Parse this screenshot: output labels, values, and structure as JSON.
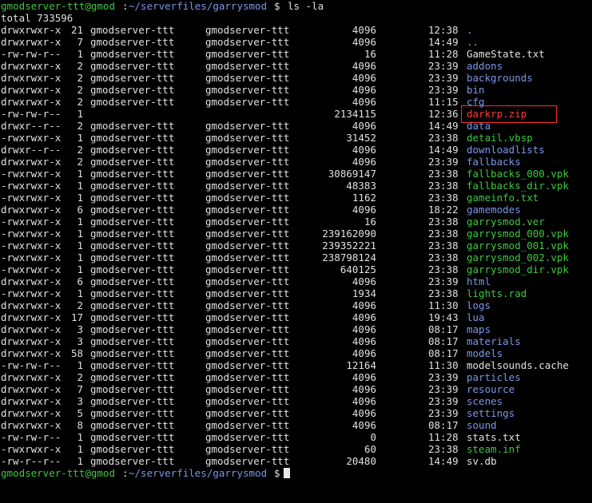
{
  "prompt": {
    "user_host": "gmodserver-ttt@gmod",
    "path": "~/serverfiles/garrysmod",
    "symbol": "$",
    "command": "ls -la"
  },
  "total_line": "total 733596",
  "colors": {
    "background": "#000000",
    "prompt_user": "#3cc83c",
    "directory": "#7a96e8",
    "executable": "#3cc83c",
    "highlight_border": "#ff2a2a"
  },
  "rows": [
    {
      "perm": "drwxrwxr-x",
      "links": "21",
      "owner": "gmodserver-ttt",
      "group": "gmodserver-ttt",
      "size": "4096",
      "time": "12:38",
      "name": ".",
      "type": "dir"
    },
    {
      "perm": "drwxrwxr-x",
      "links": "7",
      "owner": "gmodserver-ttt",
      "group": "gmodserver-ttt",
      "size": "4096",
      "time": "14:49",
      "name": "..",
      "type": "dir"
    },
    {
      "perm": "-rw-rw-r--",
      "links": "1",
      "owner": "gmodserver-ttt",
      "group": "gmodserver-ttt",
      "size": "16",
      "time": "11:28",
      "name": "GameState.txt",
      "type": "file"
    },
    {
      "perm": "drwxrwxr-x",
      "links": "2",
      "owner": "gmodserver-ttt",
      "group": "gmodserver-ttt",
      "size": "4096",
      "time": "23:39",
      "name": "addons",
      "type": "dir"
    },
    {
      "perm": "drwxrwxr-x",
      "links": "2",
      "owner": "gmodserver-ttt",
      "group": "gmodserver-ttt",
      "size": "4096",
      "time": "23:39",
      "name": "backgrounds",
      "type": "dir"
    },
    {
      "perm": "drwxrwxr-x",
      "links": "2",
      "owner": "gmodserver-ttt",
      "group": "gmodserver-ttt",
      "size": "4096",
      "time": "23:39",
      "name": "bin",
      "type": "dir"
    },
    {
      "perm": "drwxrwxr-x",
      "links": "2",
      "owner": "gmodserver-ttt",
      "group": "gmodserver-ttt",
      "size": "4096",
      "time": "11:15",
      "name": "cfg",
      "type": "dir"
    },
    {
      "perm": "-rw-rw-r--",
      "links": "1",
      "owner": "",
      "group": "",
      "size": "2134115",
      "time": "12:36",
      "name": "darkrp.zip",
      "type": "highlight"
    },
    {
      "perm": "drwxr--r--",
      "links": "2",
      "owner": "gmodserver-ttt",
      "group": "gmodserver-ttt",
      "size": "4096",
      "time": "14:49",
      "name": "data",
      "type": "dir"
    },
    {
      "perm": "-rwxrwxr-x",
      "links": "1",
      "owner": "gmodserver-ttt",
      "group": "gmodserver-ttt",
      "size": "31452",
      "time": "23:38",
      "name": "detail.vbsp",
      "type": "exec"
    },
    {
      "perm": "drwxr--r--",
      "links": "2",
      "owner": "gmodserver-ttt",
      "group": "gmodserver-ttt",
      "size": "4096",
      "time": "14:49",
      "name": "downloadlists",
      "type": "dir"
    },
    {
      "perm": "drwxrwxr-x",
      "links": "2",
      "owner": "gmodserver-ttt",
      "group": "gmodserver-ttt",
      "size": "4096",
      "time": "23:39",
      "name": "fallbacks",
      "type": "dir"
    },
    {
      "perm": "-rwxrwxr-x",
      "links": "1",
      "owner": "gmodserver-ttt",
      "group": "gmodserver-ttt",
      "size": "30869147",
      "time": "23:38",
      "name": "fallbacks_000.vpk",
      "type": "exec"
    },
    {
      "perm": "-rwxrwxr-x",
      "links": "1",
      "owner": "gmodserver-ttt",
      "group": "gmodserver-ttt",
      "size": "48383",
      "time": "23:38",
      "name": "fallbacks_dir.vpk",
      "type": "exec"
    },
    {
      "perm": "-rwxrwxr-x",
      "links": "1",
      "owner": "gmodserver-ttt",
      "group": "gmodserver-ttt",
      "size": "1162",
      "time": "23:38",
      "name": "gameinfo.txt",
      "type": "exec"
    },
    {
      "perm": "drwxrwxr-x",
      "links": "6",
      "owner": "gmodserver-ttt",
      "group": "gmodserver-ttt",
      "size": "4096",
      "time": "18:22",
      "name": "gamemodes",
      "type": "dir"
    },
    {
      "perm": "-rwxrwxr-x",
      "links": "1",
      "owner": "gmodserver-ttt",
      "group": "gmodserver-ttt",
      "size": "16",
      "time": "23:38",
      "name": "garrysmod.ver",
      "type": "exec"
    },
    {
      "perm": "-rwxrwxr-x",
      "links": "1",
      "owner": "gmodserver-ttt",
      "group": "gmodserver-ttt",
      "size": "239162090",
      "time": "23:38",
      "name": "garrysmod_000.vpk",
      "type": "exec"
    },
    {
      "perm": "-rwxrwxr-x",
      "links": "1",
      "owner": "gmodserver-ttt",
      "group": "gmodserver-ttt",
      "size": "239352221",
      "time": "23:38",
      "name": "garrysmod_001.vpk",
      "type": "exec"
    },
    {
      "perm": "-rwxrwxr-x",
      "links": "1",
      "owner": "gmodserver-ttt",
      "group": "gmodserver-ttt",
      "size": "238798124",
      "time": "23:38",
      "name": "garrysmod_002.vpk",
      "type": "exec"
    },
    {
      "perm": "-rwxrwxr-x",
      "links": "1",
      "owner": "gmodserver-ttt",
      "group": "gmodserver-ttt",
      "size": "640125",
      "time": "23:38",
      "name": "garrysmod_dir.vpk",
      "type": "exec"
    },
    {
      "perm": "drwxrwxr-x",
      "links": "6",
      "owner": "gmodserver-ttt",
      "group": "gmodserver-ttt",
      "size": "4096",
      "time": "23:39",
      "name": "html",
      "type": "dir"
    },
    {
      "perm": "-rwxrwxr-x",
      "links": "1",
      "owner": "gmodserver-ttt",
      "group": "gmodserver-ttt",
      "size": "1934",
      "time": "23:38",
      "name": "lights.rad",
      "type": "exec"
    },
    {
      "perm": "drwxrwxr-x",
      "links": "2",
      "owner": "gmodserver-ttt",
      "group": "gmodserver-ttt",
      "size": "4096",
      "time": "11:30",
      "name": "logs",
      "type": "dir"
    },
    {
      "perm": "drwxrwxr-x",
      "links": "17",
      "owner": "gmodserver-ttt",
      "group": "gmodserver-ttt",
      "size": "4096",
      "time": "19:43",
      "name": "lua",
      "type": "dir"
    },
    {
      "perm": "drwxrwxr-x",
      "links": "3",
      "owner": "gmodserver-ttt",
      "group": "gmodserver-ttt",
      "size": "4096",
      "time": "08:17",
      "name": "maps",
      "type": "dir"
    },
    {
      "perm": "drwxrwxr-x",
      "links": "3",
      "owner": "gmodserver-ttt",
      "group": "gmodserver-ttt",
      "size": "4096",
      "time": "08:17",
      "name": "materials",
      "type": "dir"
    },
    {
      "perm": "drwxrwxr-x",
      "links": "58",
      "owner": "gmodserver-ttt",
      "group": "gmodserver-ttt",
      "size": "4096",
      "time": "08:17",
      "name": "models",
      "type": "dir"
    },
    {
      "perm": "-rw-rw-r--",
      "links": "1",
      "owner": "gmodserver-ttt",
      "group": "gmodserver-ttt",
      "size": "12164",
      "time": "11:30",
      "name": "modelsounds.cache",
      "type": "file"
    },
    {
      "perm": "drwxrwxr-x",
      "links": "2",
      "owner": "gmodserver-ttt",
      "group": "gmodserver-ttt",
      "size": "4096",
      "time": "23:39",
      "name": "particles",
      "type": "dir"
    },
    {
      "perm": "drwxrwxr-x",
      "links": "7",
      "owner": "gmodserver-ttt",
      "group": "gmodserver-ttt",
      "size": "4096",
      "time": "23:39",
      "name": "resource",
      "type": "dir"
    },
    {
      "perm": "drwxrwxr-x",
      "links": "3",
      "owner": "gmodserver-ttt",
      "group": "gmodserver-ttt",
      "size": "4096",
      "time": "23:39",
      "name": "scenes",
      "type": "dir"
    },
    {
      "perm": "drwxrwxr-x",
      "links": "5",
      "owner": "gmodserver-ttt",
      "group": "gmodserver-ttt",
      "size": "4096",
      "time": "23:39",
      "name": "settings",
      "type": "dir"
    },
    {
      "perm": "drwxrwxr-x",
      "links": "8",
      "owner": "gmodserver-ttt",
      "group": "gmodserver-ttt",
      "size": "4096",
      "time": "08:17",
      "name": "sound",
      "type": "dir"
    },
    {
      "perm": "-rw-rw-r--",
      "links": "1",
      "owner": "gmodserver-ttt",
      "group": "gmodserver-ttt",
      "size": "0",
      "time": "11:28",
      "name": "stats.txt",
      "type": "file"
    },
    {
      "perm": "-rwxrwxr-x",
      "links": "1",
      "owner": "gmodserver-ttt",
      "group": "gmodserver-ttt",
      "size": "60",
      "time": "23:38",
      "name": "steam.inf",
      "type": "exec"
    },
    {
      "perm": "-rw-r--r--",
      "links": "1",
      "owner": "gmodserver-ttt",
      "group": "gmodserver-ttt",
      "size": "20480",
      "time": "14:49",
      "name": "sv.db",
      "type": "file"
    }
  ]
}
